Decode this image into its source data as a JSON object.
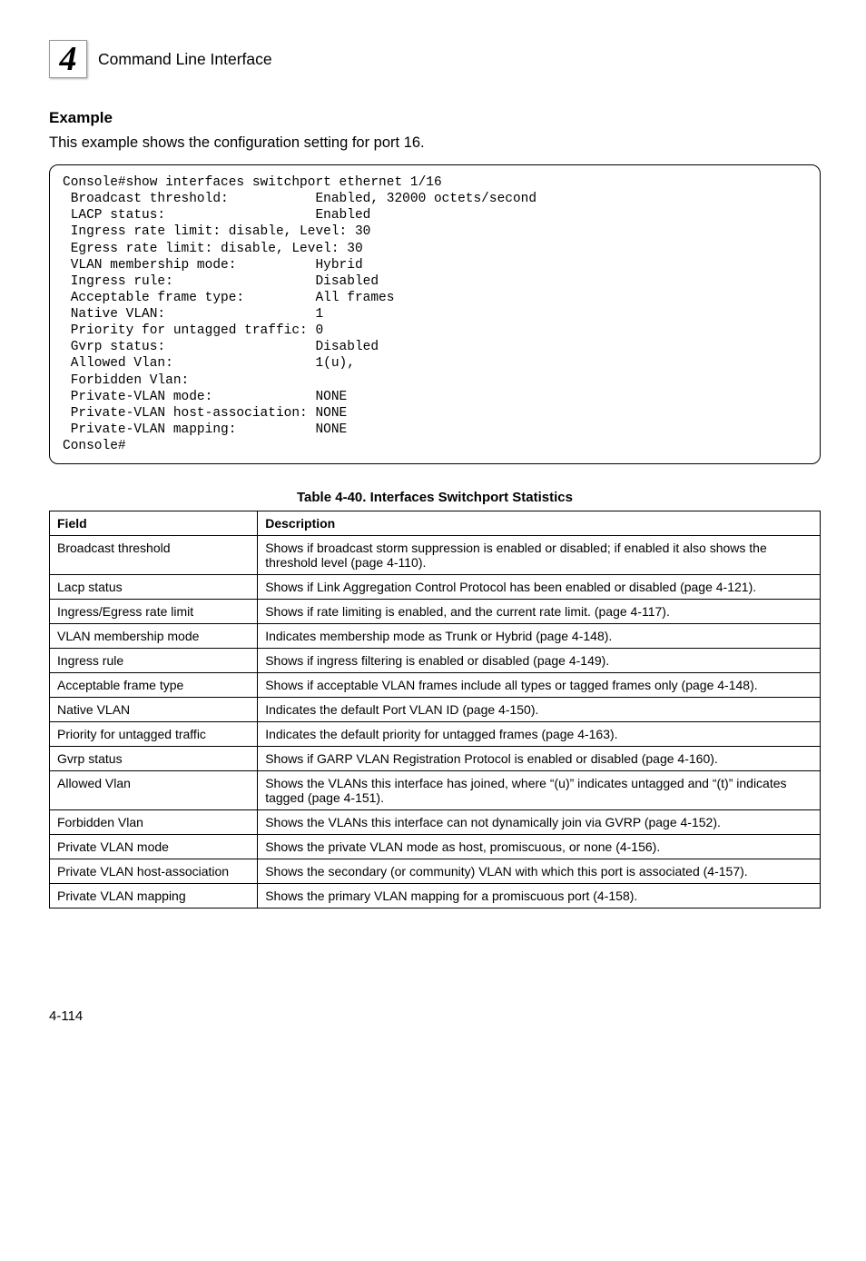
{
  "header": {
    "badge_number": "4",
    "title": "Command Line Interface"
  },
  "example": {
    "heading": "Example",
    "intro": "This example shows the configuration setting for port 16.",
    "code": "Console#show interfaces switchport ethernet 1/16\n Broadcast threshold:           Enabled, 32000 octets/second\n LACP status:                   Enabled\n Ingress rate limit: disable, Level: 30\n Egress rate limit: disable, Level: 30\n VLAN membership mode:          Hybrid\n Ingress rule:                  Disabled\n Acceptable frame type:         All frames\n Native VLAN:                   1\n Priority for untagged traffic: 0\n Gvrp status:                   Disabled\n Allowed Vlan:                  1(u),\n Forbidden Vlan:\n Private-VLAN mode:             NONE\n Private-VLAN host-association: NONE\n Private-VLAN mapping:          NONE\nConsole#"
  },
  "table": {
    "caption": "Table 4-40.   Interfaces Switchport Statistics",
    "headers": {
      "field": "Field",
      "description": "Description"
    },
    "rows": [
      {
        "field": "Broadcast threshold",
        "description": "Shows if broadcast storm suppression is enabled or disabled; if enabled it also shows the threshold level (page 4-110)."
      },
      {
        "field": "Lacp status",
        "description": "Shows if Link Aggregation Control Protocol has been enabled or disabled (page 4-121)."
      },
      {
        "field": "Ingress/Egress rate limit",
        "description": "Shows if rate limiting is enabled, and the current rate limit. (page 4-117)."
      },
      {
        "field": "VLAN membership mode",
        "description": "Indicates membership mode as Trunk or Hybrid (page 4-148)."
      },
      {
        "field": "Ingress rule",
        "description": "Shows if ingress filtering is enabled or disabled (page 4-149)."
      },
      {
        "field": "Acceptable frame type",
        "description": "Shows if acceptable VLAN frames include all types or tagged frames only (page 4-148)."
      },
      {
        "field": "Native VLAN",
        "description": "Indicates the default Port VLAN ID (page 4-150)."
      },
      {
        "field": "Priority for untagged traffic",
        "description": "Indicates the default priority for untagged frames (page 4-163)."
      },
      {
        "field": "Gvrp status",
        "description": "Shows if GARP VLAN Registration Protocol is enabled or disabled (page 4-160)."
      },
      {
        "field": "Allowed Vlan",
        "description": "Shows the VLANs this interface has joined, where “(u)” indicates untagged and “(t)” indicates tagged (page 4-151)."
      },
      {
        "field": "Forbidden Vlan",
        "description": "Shows the VLANs this interface can not dynamically join via GVRP (page 4-152)."
      },
      {
        "field": "Private VLAN mode",
        "description": "Shows the private VLAN mode as host, promiscuous, or none (4-156)."
      },
      {
        "field": "Private VLAN host-association",
        "description": "Shows the secondary (or community) VLAN with which this port is associated (4-157)."
      },
      {
        "field": "Private VLAN mapping",
        "description": "Shows the primary VLAN mapping for a promiscuous port (4-158)."
      }
    ]
  },
  "footer": {
    "page": "4-114"
  }
}
